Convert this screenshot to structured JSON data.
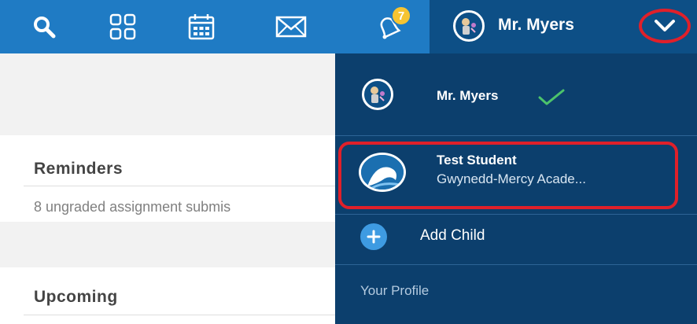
{
  "topbar": {
    "icons": {
      "search": "search-icon",
      "apps": "apps-grid-icon",
      "calendar": "calendar-icon",
      "messages": "envelope-icon",
      "notifications": "bell-icon"
    },
    "notification_count": "7",
    "user_name": "Mr. Myers"
  },
  "dashboard": {
    "reminders": {
      "title": "Reminders",
      "text": "8 ungraded assignment submis"
    },
    "upcoming": {
      "title": "Upcoming"
    }
  },
  "dropdown": {
    "parent": {
      "name": "Mr. Myers",
      "selected": true
    },
    "child": {
      "name": "Test Student",
      "school": "Gwynedd-Mercy Acade..."
    },
    "add_child_label": "Add Child",
    "profile_label": "Your Profile"
  },
  "colors": {
    "topbar_blue": "#1f7bc4",
    "topbar_dark": "#0d4f86",
    "dropdown_bg": "#0c3f6d",
    "highlight_red": "#e0202a",
    "badge_yellow": "#f6c432",
    "check_green": "#4cc36b",
    "add_blue": "#3e9be2"
  }
}
